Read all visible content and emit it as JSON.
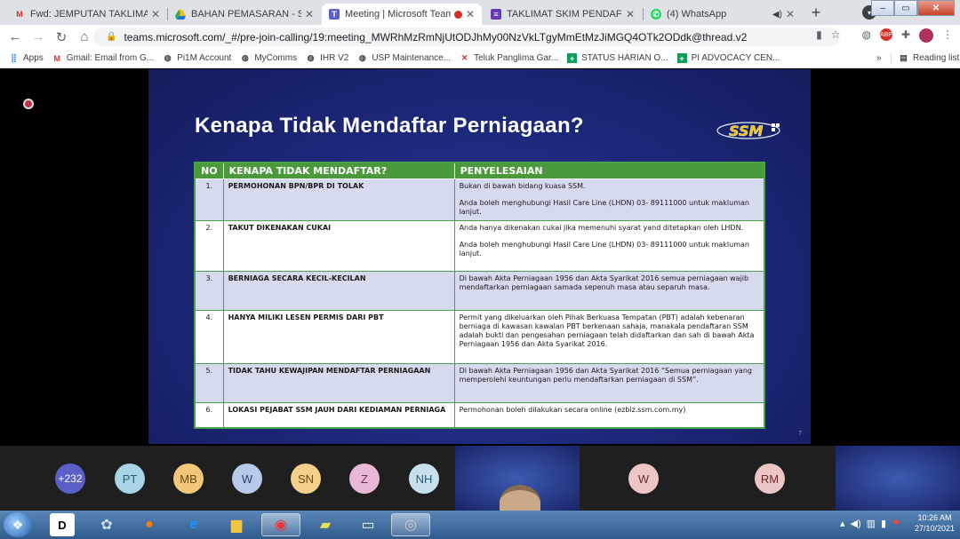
{
  "browser": {
    "tabs": [
      {
        "title": "Fwd: JEMPUTAN TAKLIMAT SKI",
        "icon": "gmail-icon",
        "color": "#d93025"
      },
      {
        "title": "BAHAN PEMASARAN - SPPP -",
        "icon": "drive-icon",
        "color": "#1a73e8"
      },
      {
        "title": "Meeting | Microsoft Teams",
        "icon": "teams-icon",
        "color": "#5b5fc7"
      },
      {
        "title": "TAKLIMAT SKIM PENDAFTARA",
        "icon": "forms-icon",
        "color": "#673ab7"
      },
      {
        "title": "(4) WhatsApp",
        "icon": "whatsapp-icon",
        "color": "#25d366"
      }
    ],
    "new_tab": "+",
    "url": "teams.microsoft.com/_#/pre-join-calling/19:meeting_MWRhMzRmNjUtODJhMy00NzVkLTgyMmEtMzJiMGQ4OTk2ODdk@thread.v2",
    "bookmarks": [
      {
        "label": "Apps",
        "icon": "apps-icon"
      },
      {
        "label": "Gmail: Email from G...",
        "icon": "gmail-icon"
      },
      {
        "label": "Pi1M Account",
        "icon": "globe-icon"
      },
      {
        "label": "MyComms",
        "icon": "globe-icon"
      },
      {
        "label": "IHR V2",
        "icon": "globe-icon"
      },
      {
        "label": "USP Maintenance...",
        "icon": "globe-icon"
      },
      {
        "label": "Teluk Panglima Gar...",
        "icon": "cross-icon"
      },
      {
        "label": "STATUS HARIAN O...",
        "icon": "sheets-icon"
      },
      {
        "label": "PI ADVOCACY CEN...",
        "icon": "sheets-icon"
      }
    ],
    "more_bookmarks": "»",
    "reading_list": "Reading list"
  },
  "slide": {
    "title": "Kenapa Tidak Mendaftar Perniagaan?",
    "logo_text": "SSM",
    "page_number": "7",
    "headers": [
      "NO",
      "KENAPA TIDAK MENDAFTAR?",
      "PENYELESAIAN"
    ],
    "rows": [
      {
        "no": "1.",
        "reason": "PERMOHONAN BPN/BPR DI TOLAK",
        "solution": [
          "Bukan di bawah bidang kuasa SSM.",
          "Anda boleh menghubungi  Hasil Care Line (LHDN) 03- 89111000  untuk makluman lanjut."
        ]
      },
      {
        "no": "2.",
        "reason": "TAKUT DIKENAKAN CUKAI",
        "solution": [
          "Anda hanya dikenakan cukai jika memenuhi syarat yand ditetapkan oleh LHDN.",
          "Anda boleh menghubungi Hasil Care Line (LHDN) 03- 89111000 untuk makluman lanjut."
        ]
      },
      {
        "no": "3.",
        "reason": "BERNIAGA SECARA KECIL-KECILAN",
        "solution": [
          "Di bawah Akta Perniagaan 1956 dan Akta Syarikat 2016 semua perniagaan wajib mendaftarkan perniagaan samada sepenuh masa atau separuh masa."
        ]
      },
      {
        "no": "4.",
        "reason": "HANYA MILIKI LESEN PERMIS DARI PBT",
        "solution": [
          "Permit yang dikeluarkan oleh Pihak Berkuasa Tempatan (PBT) adalah kebenaran berniaga di kawasan kawalan PBT berkenaan sahaja, manakala pendaftaran SSM adalah bukti dan pengesahan perniagaan telah didaftarkan dan sah di bawah Akta Perniagaan 1956 dan Akta Syarikat 2016."
        ]
      },
      {
        "no": "5.",
        "reason": "TIDAK TAHU KEWAJIPAN MENDAFTAR PERNIAGAAN",
        "solution": [
          "Di bawah Akta Perniagaan 1956 dan Akta Syarikat 2016 “Semua perniagaan yang memperolehi keuntungan perlu mendaftarkan perniagaan di SSM”."
        ]
      },
      {
        "no": "6.",
        "reason": "LOKASI PEJABAT SSM JAUH DARI KEDIAMAN PERNIAGA",
        "solution": [
          "Permohonan boleh dilakukan secara online (ezbiz.ssm.com.my)"
        ]
      }
    ]
  },
  "participants": [
    {
      "initials": "+232",
      "color": "#5b5fc7",
      "text_color": "#ffffff"
    },
    {
      "initials": "PT",
      "color": "#a8d4e6",
      "text_color": "#2b5b73"
    },
    {
      "initials": "MB",
      "color": "#f2c77a",
      "text_color": "#6b4a10"
    },
    {
      "initials": "W",
      "color": "#b9c9ea",
      "text_color": "#2c3e6e"
    },
    {
      "initials": "SN",
      "color": "#f5d08a",
      "text_color": "#6b4a10"
    },
    {
      "initials": "Z",
      "color": "#e8b8d4",
      "text_color": "#6b2a55"
    },
    {
      "initials": "NH",
      "color": "#c8e0ea",
      "text_color": "#2b5b73"
    },
    {
      "initials": "W",
      "color": "#ecc6c6",
      "text_color": "#6b2a2a"
    },
    {
      "initials": "RM",
      "color": "#ecc6c6",
      "text_color": "#6b2a2a"
    }
  ],
  "taskbar": {
    "time": "10:26 AM",
    "date": "27/10/2021"
  }
}
